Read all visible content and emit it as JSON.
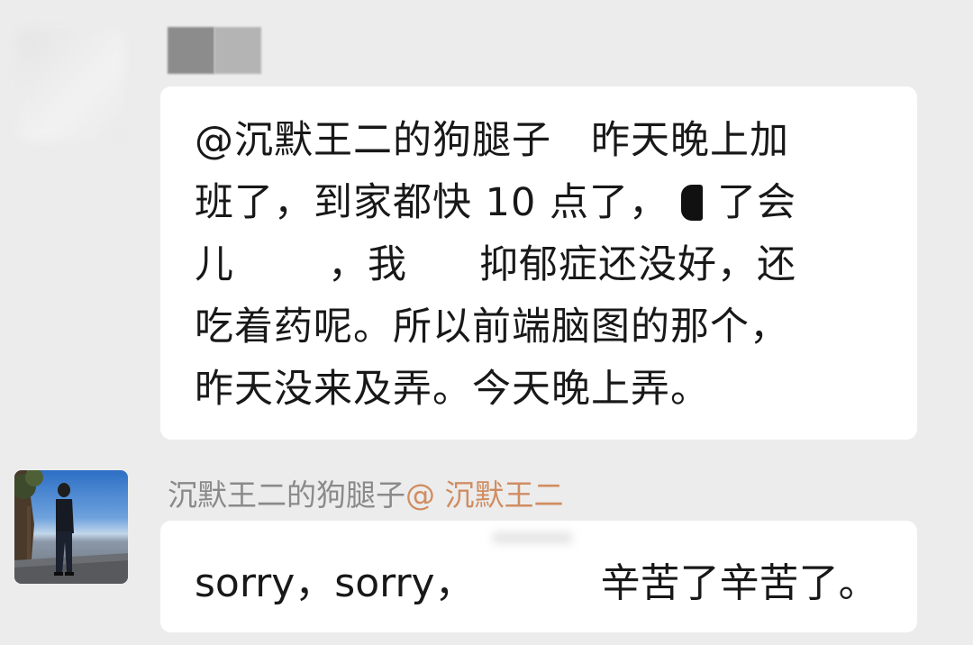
{
  "messages": [
    {
      "sender_redacted": true,
      "lines": [
        {
          "a": "@沉默王二的狗腿子　昨天晚上加"
        },
        {
          "a": "班了，到家都快 10 点了，",
          "b": "了会"
        },
        {
          "a": "儿",
          "b": "，我",
          "c": "抑郁症还没好，还"
        },
        {
          "a": "吃着药呢。所以前端脑图的那个，"
        },
        {
          "a": "昨天没来及弄。今天晚上弄。"
        }
      ]
    },
    {
      "sender_name": "沉默王二的狗腿子",
      "mention": "@ 沉默王二",
      "line_a": "sorry，sorry，",
      "line_b": "辛苦了辛苦了。"
    }
  ]
}
